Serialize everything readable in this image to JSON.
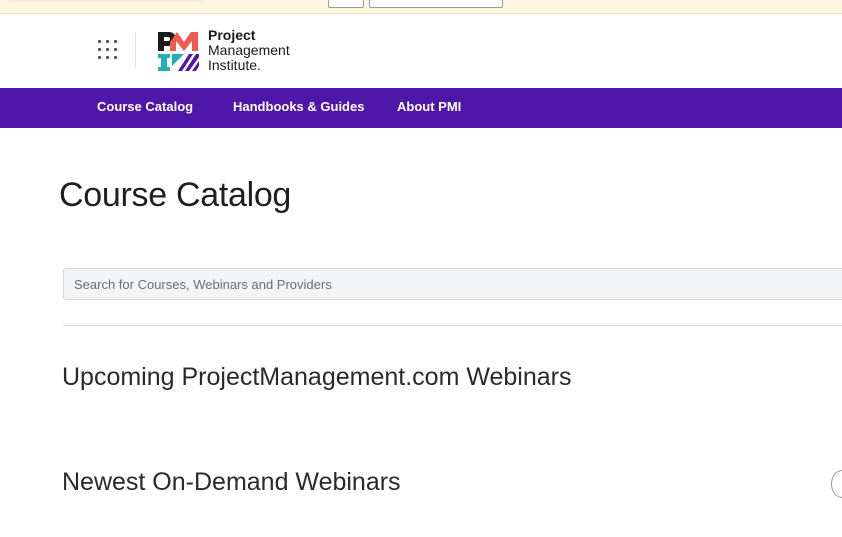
{
  "header": {
    "logo": {
      "line1": "Project",
      "line2": "Management",
      "line3": "Institute."
    }
  },
  "nav": {
    "items": [
      {
        "label": "Course Catalog"
      },
      {
        "label": "Handbooks & Guides"
      },
      {
        "label": "About PMI"
      }
    ]
  },
  "main": {
    "title": "Course Catalog",
    "search": {
      "placeholder": "Search for Courses, Webinars and Providers",
      "value": ""
    },
    "sections": [
      {
        "heading": "Upcoming ProjectManagement.com Webinars"
      },
      {
        "heading": "Newest On-Demand Webinars"
      }
    ]
  },
  "colors": {
    "nav_background": "#4f17a8",
    "logo_teal": "#22b0b8",
    "logo_coral": "#ef5b4e",
    "logo_purple": "#4f17a8",
    "logo_dark": "#1b1b1b"
  },
  "icons": {
    "apps": "grid-dots-icon",
    "logo_mark": "pmi-logo-mark-icon"
  }
}
